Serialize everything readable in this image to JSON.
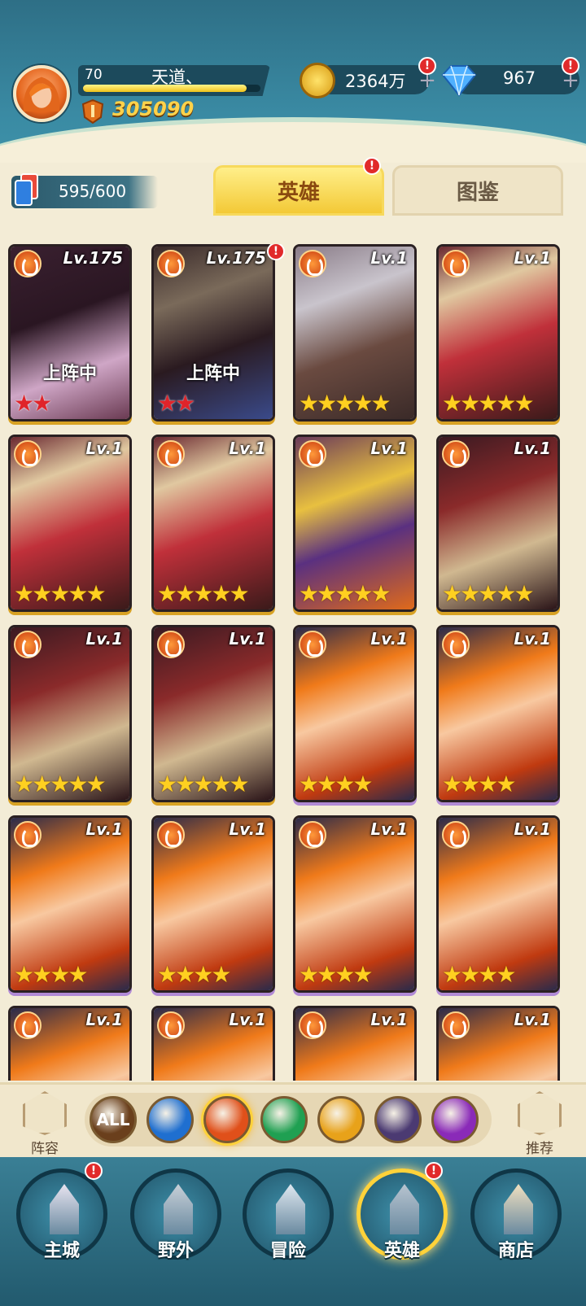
{
  "player": {
    "level": "70",
    "name": "天道、",
    "exp_fraction": 0.92,
    "power": "305090"
  },
  "resources": {
    "gold": "2364万",
    "diamonds": "967",
    "plus_symbol": "+",
    "alert_symbol": "!"
  },
  "hero_count": "595/600",
  "tabs": [
    {
      "label": "英雄",
      "selected": true,
      "alert": true
    },
    {
      "label": "图鉴",
      "selected": false,
      "alert": false
    }
  ],
  "heroes": [
    {
      "level": "Lv.175",
      "status": "上阵中",
      "stars": 2,
      "star_color": "red",
      "art": "dark",
      "alert": false
    },
    {
      "level": "Lv.175",
      "status": "上阵中",
      "stars": 2,
      "star_color": "red",
      "art": "white",
      "alert": true
    },
    {
      "level": "Lv.1",
      "status": "",
      "stars": 5,
      "star_color": "gold",
      "art": "silver",
      "alert": false
    },
    {
      "level": "Lv.1",
      "status": "",
      "stars": 5,
      "star_color": "gold",
      "art": "skull",
      "alert": false
    },
    {
      "level": "Lv.1",
      "status": "",
      "stars": 5,
      "star_color": "gold",
      "art": "skull",
      "alert": false
    },
    {
      "level": "Lv.1",
      "status": "",
      "stars": 5,
      "star_color": "gold",
      "art": "skull",
      "alert": false
    },
    {
      "level": "Lv.1",
      "status": "",
      "stars": 5,
      "star_color": "gold",
      "art": "blonde",
      "alert": false
    },
    {
      "level": "Lv.1",
      "status": "",
      "stars": 5,
      "star_color": "gold",
      "art": "mask",
      "alert": false
    },
    {
      "level": "Lv.1",
      "status": "",
      "stars": 5,
      "star_color": "gold",
      "art": "mask",
      "alert": false
    },
    {
      "level": "Lv.1",
      "status": "",
      "stars": 5,
      "star_color": "gold",
      "art": "mask",
      "alert": false
    },
    {
      "level": "Lv.1",
      "status": "",
      "stars": 4,
      "star_color": "gold",
      "art": "elf",
      "alert": false
    },
    {
      "level": "Lv.1",
      "status": "",
      "stars": 4,
      "star_color": "gold",
      "art": "elf",
      "alert": false
    },
    {
      "level": "Lv.1",
      "status": "",
      "stars": 4,
      "star_color": "gold",
      "art": "elf",
      "alert": false
    },
    {
      "level": "Lv.1",
      "status": "",
      "stars": 4,
      "star_color": "gold",
      "art": "elf",
      "alert": false
    },
    {
      "level": "Lv.1",
      "status": "",
      "stars": 4,
      "star_color": "gold",
      "art": "elf",
      "alert": false
    },
    {
      "level": "Lv.1",
      "status": "",
      "stars": 4,
      "star_color": "gold",
      "art": "elf",
      "alert": false
    },
    {
      "level": "Lv.1",
      "status": "",
      "stars": 0,
      "star_color": "gold",
      "art": "elf",
      "alert": false
    },
    {
      "level": "Lv.1",
      "status": "",
      "stars": 0,
      "star_color": "gold",
      "art": "elf",
      "alert": false
    },
    {
      "level": "Lv.1",
      "status": "",
      "stars": 0,
      "star_color": "gold",
      "art": "elf",
      "alert": false
    },
    {
      "level": "Lv.1",
      "status": "",
      "stars": 0,
      "star_color": "gold",
      "art": "elf",
      "alert": false
    }
  ],
  "filters": {
    "lineup_label": "阵容",
    "recommend_label": "推荐",
    "elements": [
      {
        "name": "all",
        "label": "ALL",
        "color": "#6a3f1c",
        "selected": false
      },
      {
        "name": "water",
        "label": "",
        "color": "#1f6fd0",
        "selected": false
      },
      {
        "name": "fire",
        "label": "",
        "color": "#e0501a",
        "selected": true
      },
      {
        "name": "wind",
        "label": "",
        "color": "#1fa052",
        "selected": false
      },
      {
        "name": "light",
        "label": "",
        "color": "#e8a21a",
        "selected": false
      },
      {
        "name": "dark",
        "label": "",
        "color": "#4b3a72",
        "selected": false
      },
      {
        "name": "arcane",
        "label": "",
        "color": "#8a2ab8",
        "selected": false
      }
    ]
  },
  "nav": [
    {
      "label": "主城",
      "icon": "castle-icon",
      "alert": true,
      "active": false
    },
    {
      "label": "野外",
      "icon": "portal-icon",
      "alert": false,
      "active": false
    },
    {
      "label": "冒险",
      "icon": "sword-icon",
      "alert": false,
      "active": false
    },
    {
      "label": "英雄",
      "icon": "helmet-icon",
      "alert": true,
      "active": true
    },
    {
      "label": "商店",
      "icon": "shop-icon",
      "alert": false,
      "active": false
    }
  ]
}
